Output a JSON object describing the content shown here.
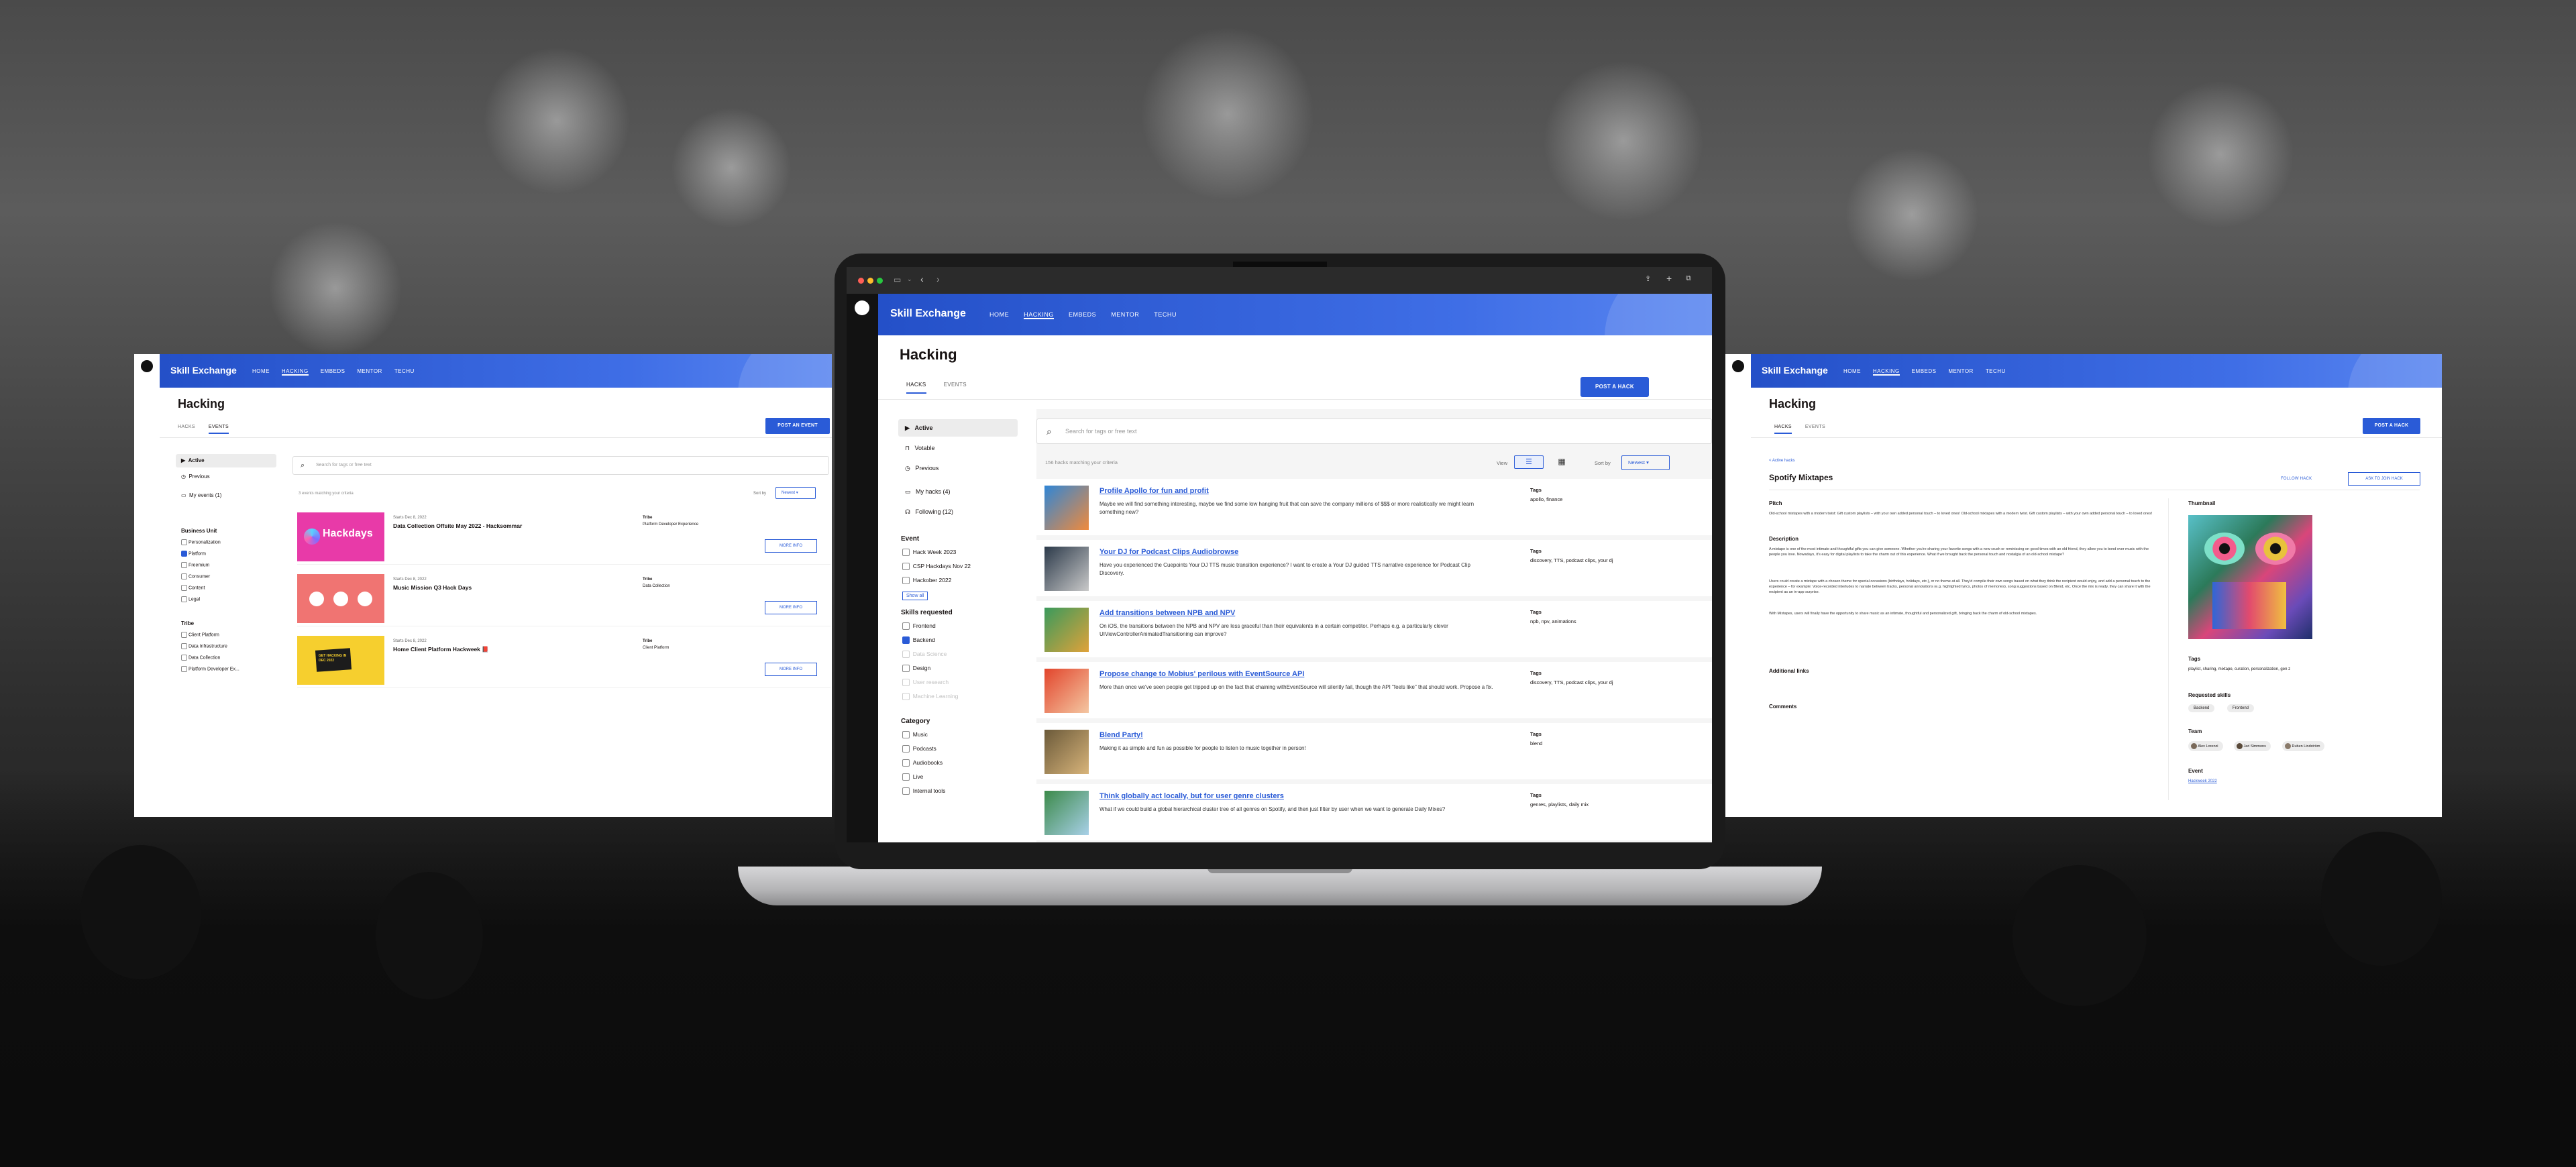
{
  "left": {
    "brand": "Skill Exchange",
    "nav": [
      "HOME",
      "HACKING",
      "EMBEDS",
      "MENTOR",
      "TECHU"
    ],
    "nav_active": "HACKING",
    "title": "Hacking",
    "tabs": [
      "HACKS",
      "EVENTS"
    ],
    "tab_active": "EVENTS",
    "post_button": "POST AN EVENT",
    "search_placeholder": "Search for tags or free text",
    "result_count": "3 events matching your criteria",
    "sort_label": "Sort by",
    "sort_value": "Newest",
    "sidebar": [
      "Active",
      "Previous",
      "My events (1)"
    ],
    "filter_groups": [
      {
        "title": "Business Unit",
        "items": [
          "Personalization",
          "Platform",
          "Freemium",
          "Consumer",
          "Content",
          "Legal"
        ],
        "checked": [
          1
        ]
      },
      {
        "title": "Tribe",
        "items": [
          "Client Platform",
          "Data Infrastructure",
          "Data Collection",
          "Platform Developer Ex..."
        ],
        "checked": []
      }
    ],
    "events": [
      {
        "date": "Starts Dec 8, 2022",
        "title": "Data Collection Offsite May 2022 - Hacksommar",
        "tribe_label": "Tribe",
        "tribe": "Platform Developer Experience",
        "button": "MORE INFO",
        "thumb_text": "Hackdays",
        "thumb_color": "#e83aa8"
      },
      {
        "date": "Starts Dec 8, 2022",
        "title": "Music Mission Q3 Hack Days",
        "tribe_label": "Tribe",
        "tribe": "Data Collection",
        "button": "MORE INFO",
        "thumb_text": "",
        "thumb_color": "#f07472"
      },
      {
        "date": "Starts Dec 8, 2022",
        "title": "Home Client Platform Hackweek 📕",
        "tribe_label": "Tribe",
        "tribe": "Client Platform",
        "button": "MORE INFO",
        "thumb_text": "GET HACKING IN DEC 2022",
        "thumb_color": "#f6cf2e"
      }
    ]
  },
  "center": {
    "brand": "Skill Exchange",
    "nav": [
      "HOME",
      "HACKING",
      "EMBEDS",
      "MENTOR",
      "TECHU"
    ],
    "nav_active": "HACKING",
    "title": "Hacking",
    "tabs": [
      "HACKS",
      "EVENTS"
    ],
    "tab_active": "HACKS",
    "post_button": "POST A HACK",
    "search_placeholder": "Search for tags or free text",
    "result_count": "156 hacks matching your criteria",
    "view_label": "View",
    "sort_label": "Sort by",
    "sort_value": "Newest",
    "sidebar": [
      "Active",
      "Votable",
      "Previous",
      "My hacks (4)",
      "Following (12)"
    ],
    "event_title": "Event",
    "events": [
      "Hack Week 2023",
      "CSP Hackdays Nov 22",
      "Hackober 2022"
    ],
    "show_all": "Show all",
    "skills_title": "Skills requested",
    "skills": [
      "Frontend",
      "Backend",
      "Data Science",
      "Design",
      "User research",
      "Machine Learning"
    ],
    "skills_checked": [
      1
    ],
    "skills_dim": [
      2,
      4,
      5
    ],
    "category_title": "Category",
    "categories": [
      "Music",
      "Podcasts",
      "Audiobooks",
      "Live",
      "Internal tools"
    ],
    "tags_label": "Tags",
    "hacks": [
      {
        "title": "Profile Apollo for fun and profit",
        "desc": "Maybe we will find something interesting, maybe we find some low hanging fruit that can save the company millions of $$$ or more realistically we might learn something new?",
        "tags": "apollo, finance",
        "c1": "#2f86d6",
        "c2": "#f08a3c"
      },
      {
        "title": "Your DJ for Podcast Clips Audiobrowse",
        "desc": "Have you experienced the Cuepoints Your DJ TTS music transition experience? I want to create a Your DJ guided TTS narrative experience for Podcast Clip Discovery.",
        "tags": "discovery, TTS, podcast clips, your dj",
        "c1": "#2c3a4a",
        "c2": "#c9c9c9"
      },
      {
        "title": "Add transitions between NPB and NPV",
        "desc": "On iOS, the transitions between the NPB and NPV are less graceful than their equivalents in a certain competitor. Perhaps e.g. a particularly clever UIViewControllerAnimatedTransitioning can improve?",
        "tags": "npb, npv, animations",
        "c1": "#3a9a5c",
        "c2": "#e0a23a"
      },
      {
        "title": "Propose change to Mobius' perilous with EventSource API",
        "desc": "More than once we've seen people get tripped up on the fact that chaining withEventSource will silently fail, though the API \"feels like\" that should work. Propose a fix.",
        "tags": "discovery, TTS, podcast clips, your dj",
        "c1": "#e2452c",
        "c2": "#f4c7a2"
      },
      {
        "title": "Blend Party!",
        "desc": "Making it as simple and fun as possible for people to listen to music together in person!",
        "tags": "blend",
        "c1": "#6b5a3a",
        "c2": "#d8b47a"
      },
      {
        "title": "Think globally act locally, but for user genre clusters",
        "desc": "What if we could build a global hierarchical cluster tree of all genres on Spotify, and then just filter by user when we want to generate Daily Mixes?",
        "tags": "genres, playlists, daily mix",
        "c1": "#3c8a4a",
        "c2": "#a8d0e8"
      }
    ]
  },
  "right": {
    "brand": "Skill Exchange",
    "nav": [
      "HOME",
      "HACKING",
      "EMBEDS",
      "MENTOR",
      "TECHU"
    ],
    "nav_active": "HACKING",
    "title": "Hacking",
    "tabs": [
      "HACKS",
      "EVENTS"
    ],
    "tab_active": "HACKS",
    "post_button": "POST A HACK",
    "back_link": "< Active hacks",
    "hack_title": "Spotify Mixtapes",
    "follow_button": "FOLLOW HACK",
    "ask_button": "ASK TO JOIN HACK",
    "pitch_title": "Pitch",
    "pitch": "Old-school mixtapes with a modern twist: Gift custom playlists – with your own added personal touch – to loved ones! Old-school mixtapes with a modern twist. Gift custom playlists – with your own added personal touch – to loved ones!",
    "description_title": "Description",
    "description": "A mixtape is one of the most intimate and thoughtful gifts you can give someone. Whether you're sharing your favorite songs with a new crush or reminiscing on good times with an old friend, they allow you to bond over music with the people you love. Nowadays, it's easy for digital playlists to take the charm out of this experience. What if we brought back the personal touch and nostalgia of an old-school mixtape?",
    "description2": "Users could create a mixtape with a chosen theme for special occasions (birthdays, holidays, etc.), or no theme at all. They'd compile their own songs based on what they think the recipient would enjoy, and add a personal touch to the experience – for example: Voice-recorded interludes to narrate between tracks, personal annotations (e.g. highlighted lyrics, photos of memories), song suggestions based on Blend, etc. Once the mix is ready, they can share it with the recipient as an in-app surprise.",
    "description3": "With Mixtapes, users will finally have the opportunity to share music as an intimate, thoughtful and personalized gift, bringing back the charm of old-school mixtapes.",
    "links_title": "Additional links",
    "comments_title": "Comments",
    "thumbnail_title": "Thumbnail",
    "tags_title": "Tags",
    "tags": "playlist, sharing, mixtape, curation, personalization, gen z",
    "skills_title": "Requested skills",
    "skills": [
      "Backend",
      "Frontend"
    ],
    "team_title": "Team",
    "team": [
      "Alex Lorenzi",
      "Jari Simmons",
      "Ruben Lindström"
    ],
    "event_title": "Event",
    "event": "Hackweek 2022"
  }
}
